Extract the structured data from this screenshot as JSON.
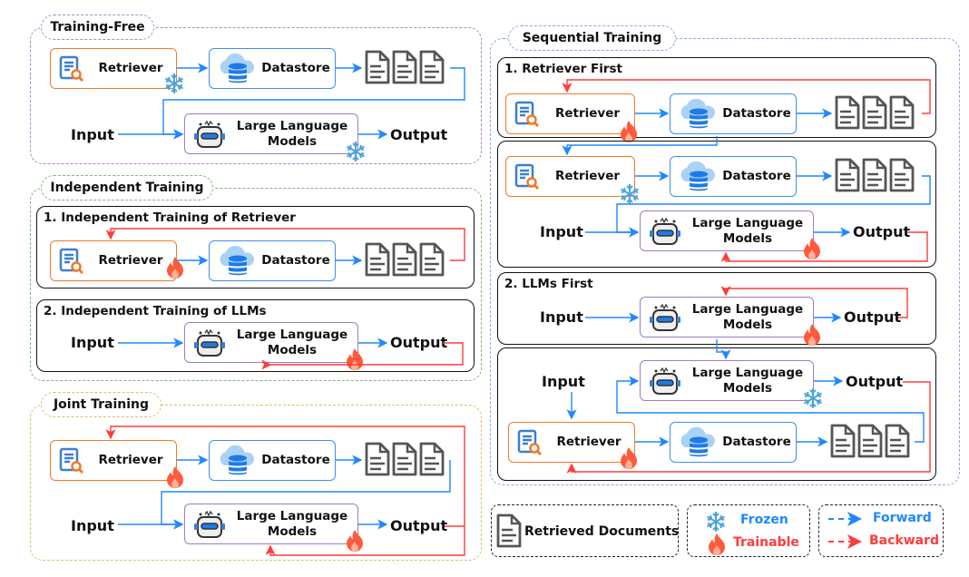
{
  "labels": {
    "retriever": "Retriever",
    "datastore": "Datastore",
    "llm": "Large Language Models",
    "input": "Input",
    "output": "Output"
  },
  "groups": {
    "training_free": {
      "title": "Training-Free",
      "color": "#a88bc4"
    },
    "independent": {
      "title": "Independent Training",
      "color": "#7fb77f",
      "sub1": "1. Independent Training of Retriever",
      "sub2": "2. Independent Training of LLMs"
    },
    "joint": {
      "title": "Joint Training",
      "color": "#d9c06a"
    },
    "sequential": {
      "title": "Sequential Training",
      "color": "#8aa8d8",
      "sub1": "1. Retriever First",
      "sub2": "2. LLMs First"
    }
  },
  "legend": {
    "documents": "Retrieved Documents",
    "frozen": "Frozen",
    "trainable": "Trainable",
    "forward": "Forward",
    "backward": "Backward"
  },
  "colors": {
    "forward": "#1e88ff",
    "backward": "#ff3b3b",
    "frozen": "#4aa3df",
    "trainable": "#ff5a3c",
    "retriever_border": "#f07a2a",
    "datastore_border": "#3d8ef0",
    "llm_border": "#a07ac8"
  },
  "icons": [
    "retriever-icon",
    "datastore-icon",
    "document-icon",
    "robot-icon",
    "snowflake-icon",
    "flame-icon"
  ]
}
